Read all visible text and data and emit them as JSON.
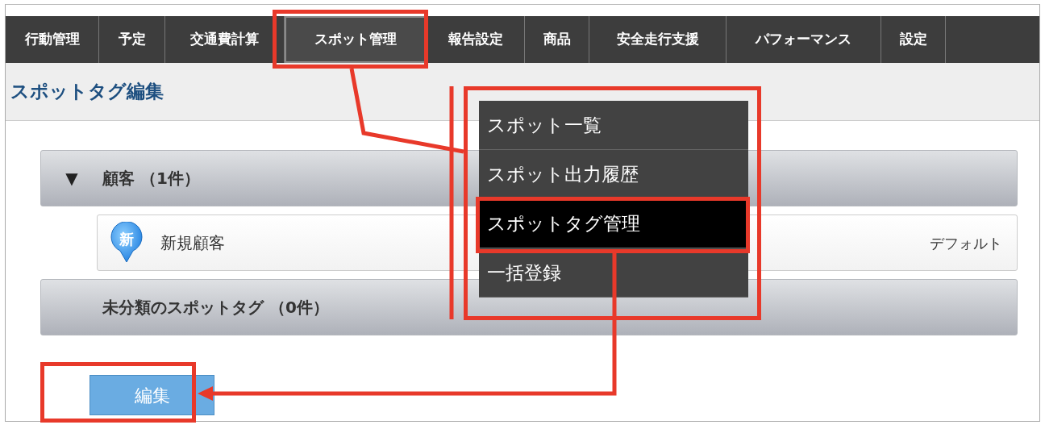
{
  "nav_tabs": [
    {
      "label": "行動管理",
      "selected": false
    },
    {
      "label": "予定",
      "selected": false
    },
    {
      "label": "交通費計算",
      "selected": false
    },
    {
      "label": "スポット管理",
      "selected": true
    },
    {
      "label": "報告設定",
      "selected": false
    },
    {
      "label": "商品",
      "selected": false
    },
    {
      "label": "安全走行支援",
      "selected": false
    },
    {
      "label": "パフォーマンス",
      "selected": false
    },
    {
      "label": "設定",
      "selected": false
    }
  ],
  "page_title": "スポットタグ編集",
  "dropdown_menu": [
    {
      "label": "スポット一覧",
      "selected": false
    },
    {
      "label": "スポット出力履歴",
      "selected": false
    },
    {
      "label": "スポットタグ管理",
      "selected": true
    },
    {
      "label": "一括登録",
      "selected": false
    }
  ],
  "groups": [
    {
      "toggle": "▼",
      "label": "顧客 （1件）",
      "items": [
        {
          "icon_text": "新",
          "name": "新規顧客",
          "tag": "デフォルト"
        }
      ]
    },
    {
      "label": "未分類のスポットタグ （0件）"
    }
  ],
  "edit_button": "編集"
}
